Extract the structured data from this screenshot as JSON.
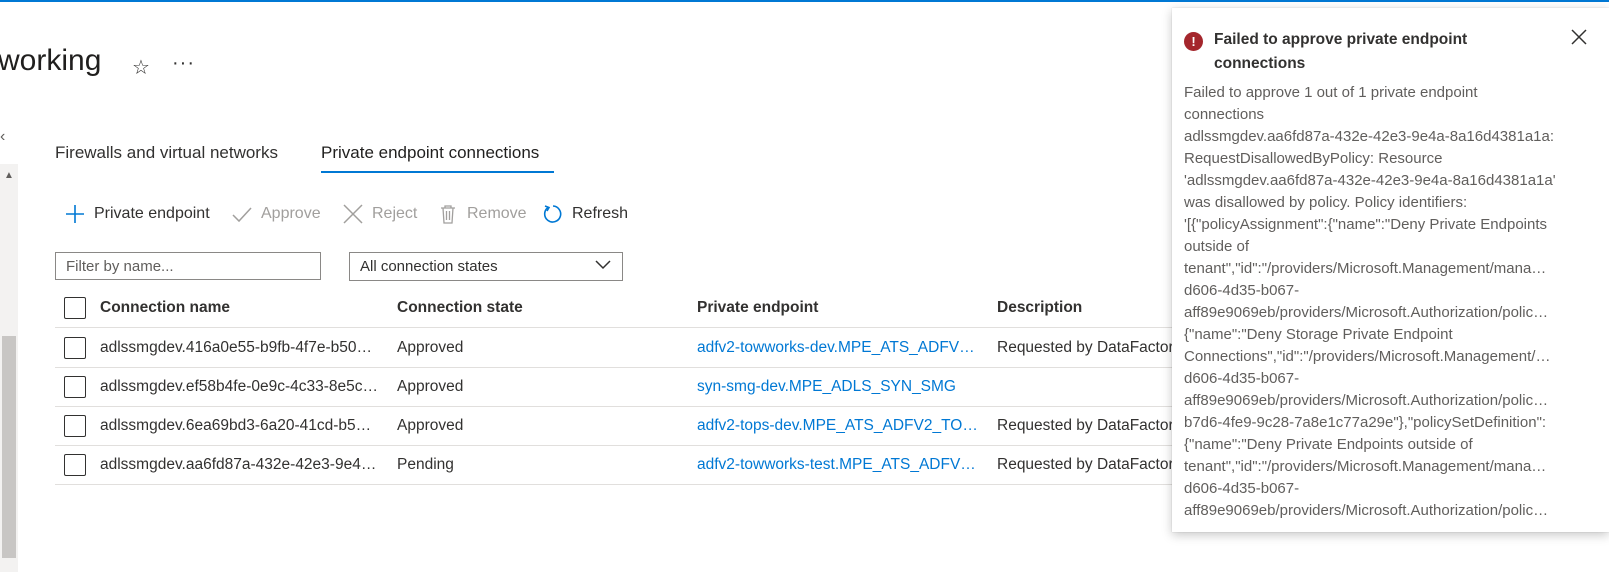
{
  "header": {
    "title": "working",
    "star_glyph": "☆",
    "more_glyph": "···"
  },
  "nav": {
    "collapse_glyph": "‹",
    "scroll_up_glyph": "▲"
  },
  "tabs": [
    {
      "label": "Firewalls and virtual networks",
      "selected": false
    },
    {
      "label": "Private endpoint connections",
      "selected": true
    }
  ],
  "toolbar": {
    "add_label": "Private endpoint",
    "approve_label": "Approve",
    "reject_label": "Reject",
    "remove_label": "Remove",
    "refresh_label": "Refresh"
  },
  "filter": {
    "placeholder": "Filter by name...",
    "state_value": "All connection states"
  },
  "table": {
    "columns": [
      "Connection name",
      "Connection state",
      "Private endpoint",
      "Description"
    ],
    "rows": [
      {
        "name": "adlssmgdev.416a0e55-b9fb-4f7e-b50…",
        "state": "Approved",
        "endpoint": "adfv2-towworks-dev.MPE_ATS_ADFV2…",
        "description": "Requested by DataFactory"
      },
      {
        "name": "adlssmgdev.ef58b4fe-0e9c-4c33-8e5c…",
        "state": "Approved",
        "endpoint": "syn-smg-dev.MPE_ADLS_SYN_SMG",
        "description": ""
      },
      {
        "name": "adlssmgdev.6ea69bd3-6a20-41cd-b5…",
        "state": "Approved",
        "endpoint": "adfv2-tops-dev.MPE_ATS_ADFV2_TOPS",
        "description": "Requested by DataFactory"
      },
      {
        "name": "adlssmgdev.aa6fd87a-432e-42e3-9e4…",
        "state": "Pending",
        "endpoint": "adfv2-towworks-test.MPE_ATS_ADFV2…",
        "description": "Requested by DataFactory"
      }
    ]
  },
  "notification": {
    "title": "Failed to approve private endpoint connections",
    "body_lines": [
      "Failed to approve 1 out of 1 private endpoint",
      "connections",
      "adlssmgdev.aa6fd87a-432e-42e3-9e4a-8a16d4381a1a:",
      "RequestDisallowedByPolicy: Resource",
      "'adlssmgdev.aa6fd87a-432e-42e3-9e4a-8a16d4381a1a'",
      "was disallowed by policy. Policy identifiers:",
      "'[{\"policyAssignment\":{\"name\":\"Deny Private Endpoints",
      "outside of",
      "tenant\",\"id\":\"/providers/Microsoft.Management/mana…",
      "d606-4d35-b067-",
      "aff89e9069eb/providers/Microsoft.Authorization/polic…",
      "{\"name\":\"Deny Storage Private Endpoint",
      "Connections\",\"id\":\"/providers/Microsoft.Management/…",
      "d606-4d35-b067-",
      "aff89e9069eb/providers/Microsoft.Authorization/polic…",
      "b7d6-4fe9-9c28-7a8e1c77a29e\"},\"policySetDefinition\":",
      "{\"name\":\"Deny Private Endpoints outside of",
      "tenant\",\"id\":\"/providers/Microsoft.Management/mana…",
      "d606-4d35-b067-",
      "aff89e9069eb/providers/Microsoft.Authorization/polic…"
    ]
  },
  "colors": {
    "accent": "#0078d4",
    "error": "#a4262c",
    "disabled": "#a19f9d"
  }
}
